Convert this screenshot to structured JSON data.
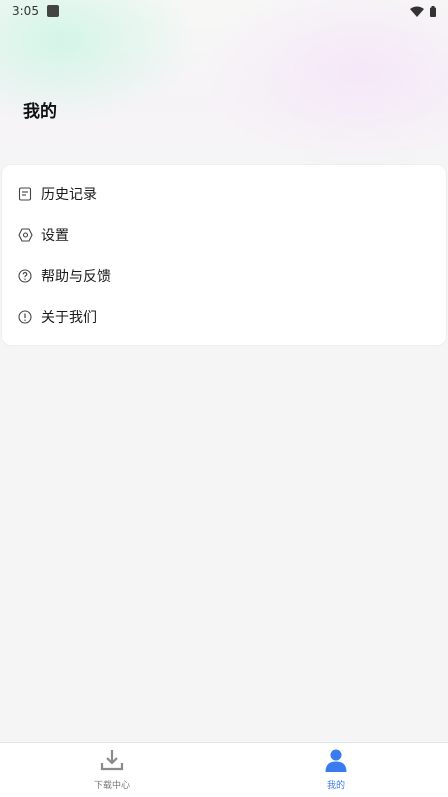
{
  "status_bar": {
    "time": "3:05"
  },
  "header": {
    "title": "我的"
  },
  "menu": {
    "items": [
      {
        "label": "历史记录",
        "icon": "history-doc-icon"
      },
      {
        "label": "设置",
        "icon": "settings-hexagon-icon"
      },
      {
        "label": "帮助与反馈",
        "icon": "help-question-icon"
      },
      {
        "label": "关于我们",
        "icon": "info-exclamation-icon"
      }
    ]
  },
  "bottom_nav": {
    "tabs": [
      {
        "label": "下载中心",
        "icon": "download-icon",
        "active": false
      },
      {
        "label": "我的",
        "icon": "person-icon",
        "active": true
      }
    ]
  },
  "colors": {
    "accent": "#3a7bf0",
    "inactive": "#777777",
    "background": "#f5f5f5"
  }
}
